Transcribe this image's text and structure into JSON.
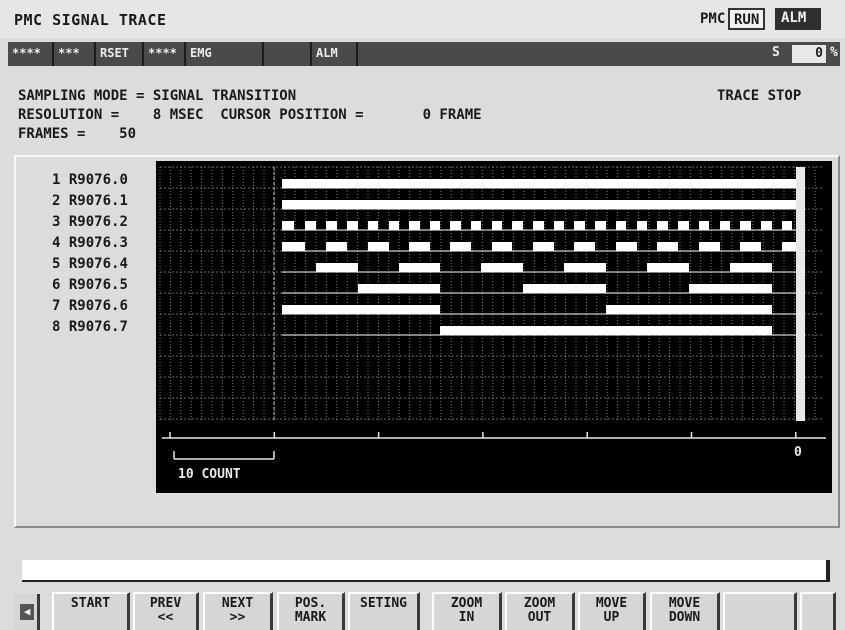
{
  "header": {
    "title": "PMC SIGNAL TRACE",
    "pmc_label": "PMC",
    "run_badge": "RUN",
    "alm_badge": "ALM"
  },
  "status_bar": {
    "cells": [
      "****",
      "***",
      "RSET",
      "****",
      "EMG",
      "",
      "ALM"
    ],
    "s_label": "S",
    "s_value": "0",
    "percent": "%"
  },
  "info": {
    "sampling_mode": "SAMPLING MODE = SIGNAL TRANSITION",
    "trace_state": "TRACE STOP",
    "resolution": "RESOLUTION =    8 MSEC  CURSOR POSITION =       0 FRAME",
    "frames": "FRAMES =    50"
  },
  "signals": [
    {
      "num": "1",
      "addr": "R9076.0"
    },
    {
      "num": "2",
      "addr": "R9076.1"
    },
    {
      "num": "3",
      "addr": "R9076.2"
    },
    {
      "num": "4",
      "addr": "R9076.3"
    },
    {
      "num": "5",
      "addr": "R9076.4"
    },
    {
      "num": "6",
      "addr": "R9076.5"
    },
    {
      "num": "7",
      "addr": "R9076.6"
    },
    {
      "num": "8",
      "addr": "R9076.7"
    }
  ],
  "graph": {
    "scale_label": "10 COUNT",
    "cursor_label": "0"
  },
  "softkeys": [
    {
      "line1": "START",
      "line2": ""
    },
    {
      "line1": "PREV",
      "line2": "<<"
    },
    {
      "line1": "NEXT",
      "line2": ">>"
    },
    {
      "line1": "POS.",
      "line2": "MARK"
    },
    {
      "line1": "SETING",
      "line2": ""
    },
    {
      "line1": "ZOOM",
      "line2": "IN"
    },
    {
      "line1": "ZOOM",
      "line2": "OUT"
    },
    {
      "line1": "MOVE",
      "line2": "UP"
    },
    {
      "line1": "MOVE",
      "line2": "DOWN"
    },
    {
      "line1": "",
      "line2": ""
    },
    {
      "line1": "",
      "line2": ""
    }
  ],
  "colors": {
    "screen_bg": "#dcdcdc",
    "graph_bg": "#000000",
    "signal_high": "#ffffff",
    "grid": "#7a7a7a"
  }
}
